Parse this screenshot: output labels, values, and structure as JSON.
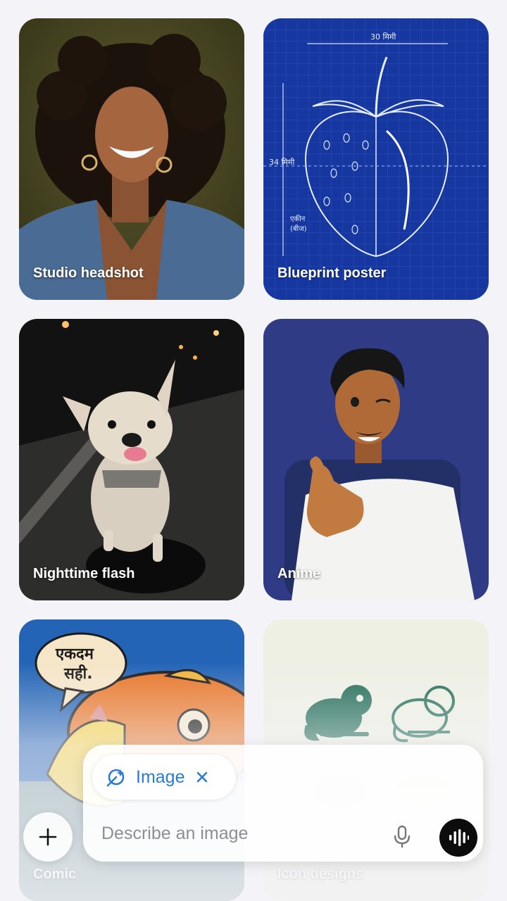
{
  "styles": [
    {
      "label": "Studio headshot"
    },
    {
      "label": "Blueprint poster",
      "dim_top": "30 मिमी",
      "dim_side": "34 मिमी",
      "note_line1": "एकीन",
      "note_line2": "(बीज)"
    },
    {
      "label": "Nighttime flash"
    },
    {
      "label": "Anime"
    },
    {
      "label": "Comic",
      "speech_line1": "एकदम",
      "speech_line2": "सही."
    },
    {
      "label": "Icon designs"
    }
  ],
  "composer": {
    "chip_label": "Image",
    "chip_icon": "image-sparkle-icon",
    "placeholder": "Describe an image",
    "add_icon": "plus-icon",
    "mic_icon": "microphone-icon",
    "voice_icon": "voice-waveform-icon"
  },
  "colors": {
    "accent": "#2a7bd5",
    "background": "#f4f3f7"
  }
}
